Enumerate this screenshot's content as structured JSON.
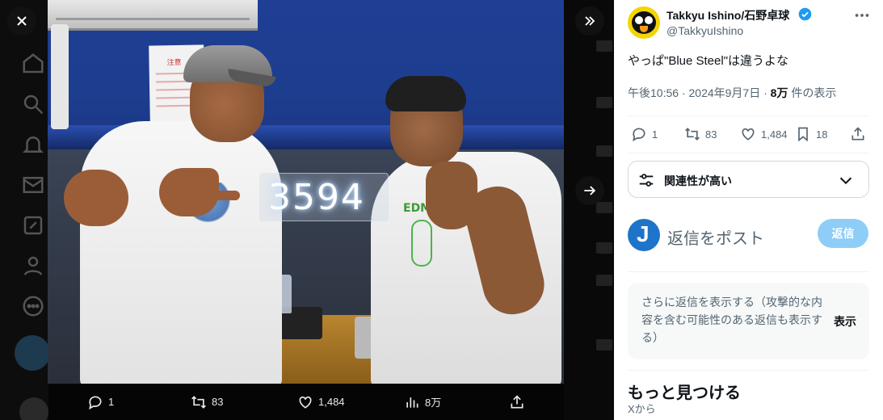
{
  "media_viewer": {
    "neon_sign_text": "3594",
    "shirt_print_text": "EDM",
    "notice_text": "注意",
    "actions": {
      "reply_count": "1",
      "repost_count": "83",
      "like_count": "1,484",
      "view_count": "8万"
    }
  },
  "tweet": {
    "author": {
      "display_name": "Takkyu Ishino/石野卓球",
      "handle": "@TakkyuIshino",
      "verified": true
    },
    "text": "やっぱ\"Blue Steel\"は違うよな",
    "meta": {
      "time": "午後10:56",
      "separator": "·",
      "date": "2024年9月7日",
      "views_number": "8万",
      "views_suffix": "件の表示"
    },
    "actions": {
      "reply_count": "1",
      "repost_count": "83",
      "like_count": "1,484",
      "bookmark_count": "18"
    }
  },
  "reply_sort": {
    "label": "関連性が高い"
  },
  "reply_composer": {
    "avatar_letter": "J",
    "placeholder": "返信をポスト",
    "button_label": "返信"
  },
  "more_replies": {
    "text": "さらに返信を表示する（攻撃的な内容を含む可能性のある返信も表示する）",
    "button_label": "表示"
  },
  "discover": {
    "title": "もっと見つける",
    "subtitle": "Xから"
  },
  "colors": {
    "accent_blue": "#1d9bf0",
    "reply_button_disabled": "#8ecdf7",
    "verified_badge": "#1d9bf0",
    "text_primary": "#0f1419",
    "text_secondary": "#536471",
    "viewer_background": "#000000"
  },
  "icons": {
    "close": "close-icon",
    "collapse": "collapse-icon",
    "next": "arrow-right-icon",
    "reply": "reply-icon",
    "repost": "repost-icon",
    "like": "heart-icon",
    "views": "bar-chart-icon",
    "share": "share-icon",
    "bookmark": "bookmark-icon",
    "sort": "sliders-icon",
    "chevron": "chevron-down-icon",
    "more": "more-icon"
  }
}
